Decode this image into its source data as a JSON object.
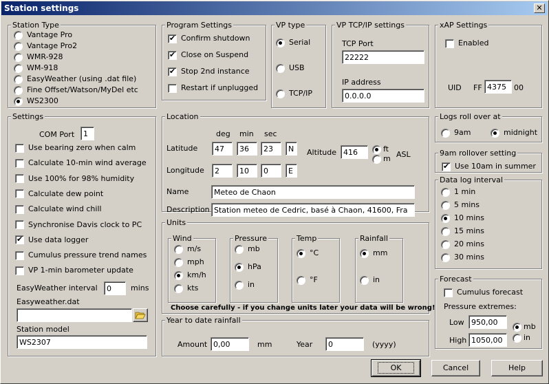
{
  "window": {
    "title": "Station settings",
    "close": "✕"
  },
  "station_type": {
    "legend": "Station Type",
    "options": [
      "Vantage Pro",
      "Vantage Pro2",
      "WMR-928",
      "WM-918",
      "EasyWeather (using .dat file)",
      "Fine Offset/Watson/MyDel etc",
      "WS2300"
    ],
    "selected": "WS2300"
  },
  "program_settings": {
    "legend": "Program Settings",
    "items": [
      {
        "label": "Confirm shutdown",
        "checked": true
      },
      {
        "label": "Close on Suspend",
        "checked": true
      },
      {
        "label": "Stop 2nd instance",
        "checked": true
      },
      {
        "label": "Restart if unplugged",
        "checked": false
      }
    ]
  },
  "vp_type": {
    "legend": "VP type",
    "options": [
      "Serial",
      "USB",
      "TCP/IP"
    ],
    "selected": "Serial"
  },
  "vp_tcpip": {
    "legend": "VP TCP/IP settings",
    "port_label": "TCP Port",
    "port_value": "22222",
    "ip_label": "IP address",
    "ip_value": "0.0.0.0"
  },
  "xap": {
    "legend": "xAP Settings",
    "enabled_label": "Enabled",
    "enabled": false,
    "uid_label": "UID",
    "uid_prefix": "FF",
    "uid_value": "4375",
    "uid_suffix": "00"
  },
  "settings": {
    "legend": "Settings",
    "com_port_label": "COM Port",
    "com_port_value": "1",
    "items": [
      {
        "label": "Use bearing zero when calm",
        "checked": false
      },
      {
        "label": "Calculate 10-min wind average",
        "checked": false
      },
      {
        "label": "Use 100% for 98% humidity",
        "checked": false
      },
      {
        "label": "Calculate dew point",
        "checked": false
      },
      {
        "label": "Calculate wind chill",
        "checked": false
      },
      {
        "label": "Synchronise Davis clock to PC",
        "checked": false
      },
      {
        "label": "Use data logger",
        "checked": true
      },
      {
        "label": "Cumulus pressure trend names",
        "checked": false
      },
      {
        "label": "VP 1-min barometer update",
        "checked": false
      }
    ],
    "ew_interval_label": "EasyWeather interval",
    "ew_interval_value": "0",
    "ew_interval_unit": "mins",
    "ew_dat_label": "Easyweather.dat",
    "ew_dat_value": "",
    "model_label": "Station model",
    "model_value": "WS2307"
  },
  "location": {
    "legend": "Location",
    "col_deg": "deg",
    "col_min": "min",
    "col_sec": "sec",
    "lat_label": "Latitude",
    "lat_deg": "47",
    "lat_min": "36",
    "lat_sec": "23",
    "lat_hemi": "N",
    "lon_label": "Longitude",
    "lon_deg": "2",
    "lon_min": "10",
    "lon_sec": "0",
    "lon_hemi": "E",
    "alt_label": "Altitude",
    "alt_value": "416",
    "alt_unit_ft": "ft",
    "alt_unit_m": "m",
    "alt_selected": "ft",
    "asl": "ASL",
    "name_label": "Name",
    "name_value": "Meteo de Chaon",
    "desc_label": "Description",
    "desc_value": "Station meteo de Cedric, basé à Chaon, 41600, Fra"
  },
  "units": {
    "legend": "Units",
    "wind": {
      "legend": "Wind",
      "options": [
        "m/s",
        "mph",
        "km/h",
        "kts"
      ],
      "selected": "km/h"
    },
    "pressure": {
      "legend": "Pressure",
      "options": [
        "mb",
        "hPa",
        "in"
      ],
      "selected": "hPa"
    },
    "temp": {
      "legend": "Temp",
      "options": [
        "°C",
        "°F"
      ],
      "selected": "°C"
    },
    "rainfall": {
      "legend": "Rainfall",
      "options": [
        "mm",
        "in"
      ],
      "selected": "mm"
    },
    "warning": "Choose carefully - if you change units later your data will be wrong!"
  },
  "ytd_rain": {
    "legend": "Year to date rainfall",
    "amount_label": "Amount",
    "amount_value": "0,00",
    "amount_unit": "mm",
    "year_label": "Year",
    "year_value": "0",
    "year_hint": "(yyyy)"
  },
  "logs_roll": {
    "legend": "Logs roll over at",
    "options": [
      "9am",
      "midnight"
    ],
    "selected": "midnight"
  },
  "rollover_9am": {
    "legend": "9am rollover setting",
    "label": "Use 10am in summer",
    "checked": true
  },
  "data_log": {
    "legend": "Data log interval",
    "options": [
      "1 min",
      "5 mins",
      "10 mins",
      "15 mins",
      "20 mins",
      "30 mins"
    ],
    "selected": "10 mins"
  },
  "forecast": {
    "legend": "Forecast",
    "cumulus_label": "Cumulus forecast",
    "cumulus_checked": false,
    "extremes_label": "Pressure extremes:",
    "low_label": "Low",
    "low_value": "950,00",
    "high_label": "High",
    "high_value": "1050,00",
    "unit_mb": "mb",
    "unit_in": "in",
    "unit_selected": "mb"
  },
  "buttons": {
    "ok": "OK",
    "cancel": "Cancel",
    "help": "Help"
  }
}
